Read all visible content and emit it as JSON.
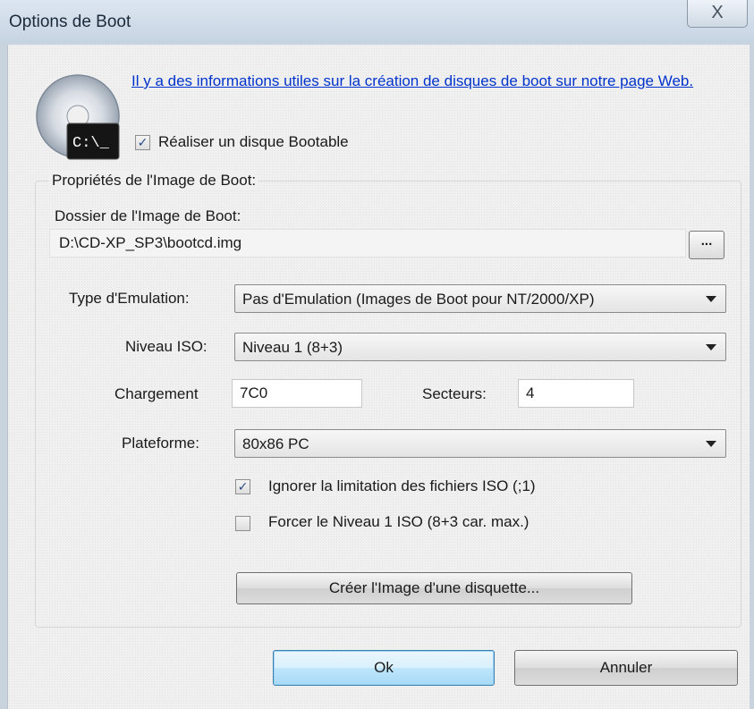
{
  "window": {
    "title": "Options de Boot",
    "close_glyph": "X"
  },
  "header": {
    "link_text": "Il y a des informations utiles sur la création de disques de boot sur notre page Web.",
    "icon_text": "C:\\_",
    "bootable_checked": true,
    "bootable_label": "Réaliser un disque Bootable"
  },
  "props": {
    "group_title": "Propriétés de l'Image de Boot:",
    "folder_label": "Dossier de l'Image de Boot:",
    "folder_value": "D:\\CD-XP_SP3\\bootcd.img",
    "browse_label": "...",
    "emulation_label": "Type d'Emulation:",
    "emulation_value": "Pas d'Emulation (Images de Boot pour NT/2000/XP)",
    "iso_label": "Niveau ISO:",
    "iso_value": "Niveau 1 (8+3)",
    "load_label": "Chargement",
    "load_value": "7C0",
    "sectors_label": "Secteurs:",
    "sectors_value": "4",
    "platform_label": "Plateforme:",
    "platform_value": "80x86 PC",
    "ignore_checked": true,
    "ignore_label": "Ignorer la limitation des fichiers ISO (;1)",
    "force_checked": false,
    "force_label": "Forcer le Niveau 1 ISO (8+3 car. max.)",
    "floppy_button": "Créer l'Image d'une disquette..."
  },
  "footer": {
    "ok_label": "Ok",
    "cancel_label": "Annuler"
  },
  "colors": {
    "link": "#0033cc",
    "default_button": "#a7d9f5",
    "check": "#2b4a8a"
  }
}
